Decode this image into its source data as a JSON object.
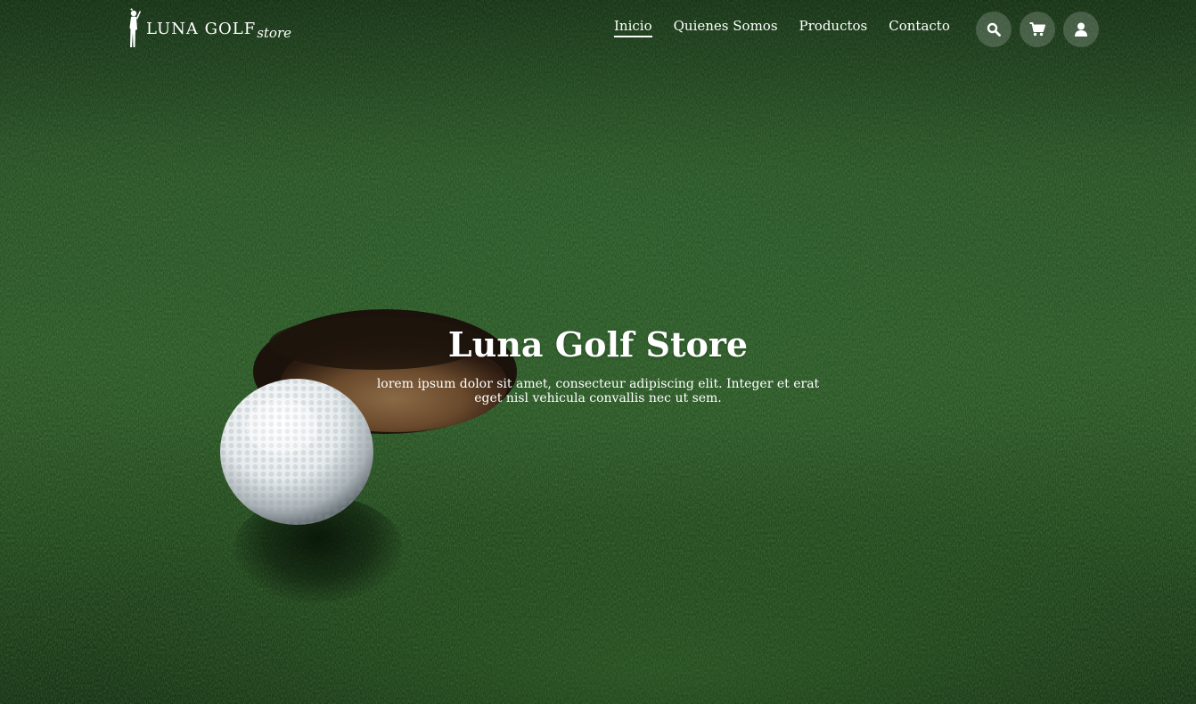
{
  "brand": {
    "logo_main": "LUNA GOLF",
    "logo_sub": "store"
  },
  "nav": {
    "items": [
      {
        "label": "Inicio",
        "active": true
      },
      {
        "label": "Quienes Somos",
        "active": false
      },
      {
        "label": "Productos",
        "active": false
      },
      {
        "label": "Contacto",
        "active": false
      }
    ]
  },
  "actions": {
    "icons": [
      "search-icon",
      "cart-icon",
      "user-icon"
    ]
  },
  "hero": {
    "title": "Luna Golf Store",
    "subtitle": "lorem ipsum dolor sit amet, consecteur adipiscing elit. Integer et erat eget nisl vehicula convallis nec ut sem."
  },
  "colors": {
    "grass": "#2d5727",
    "text": "#ffffff",
    "icon_button_bg": "#5f6f5f"
  }
}
